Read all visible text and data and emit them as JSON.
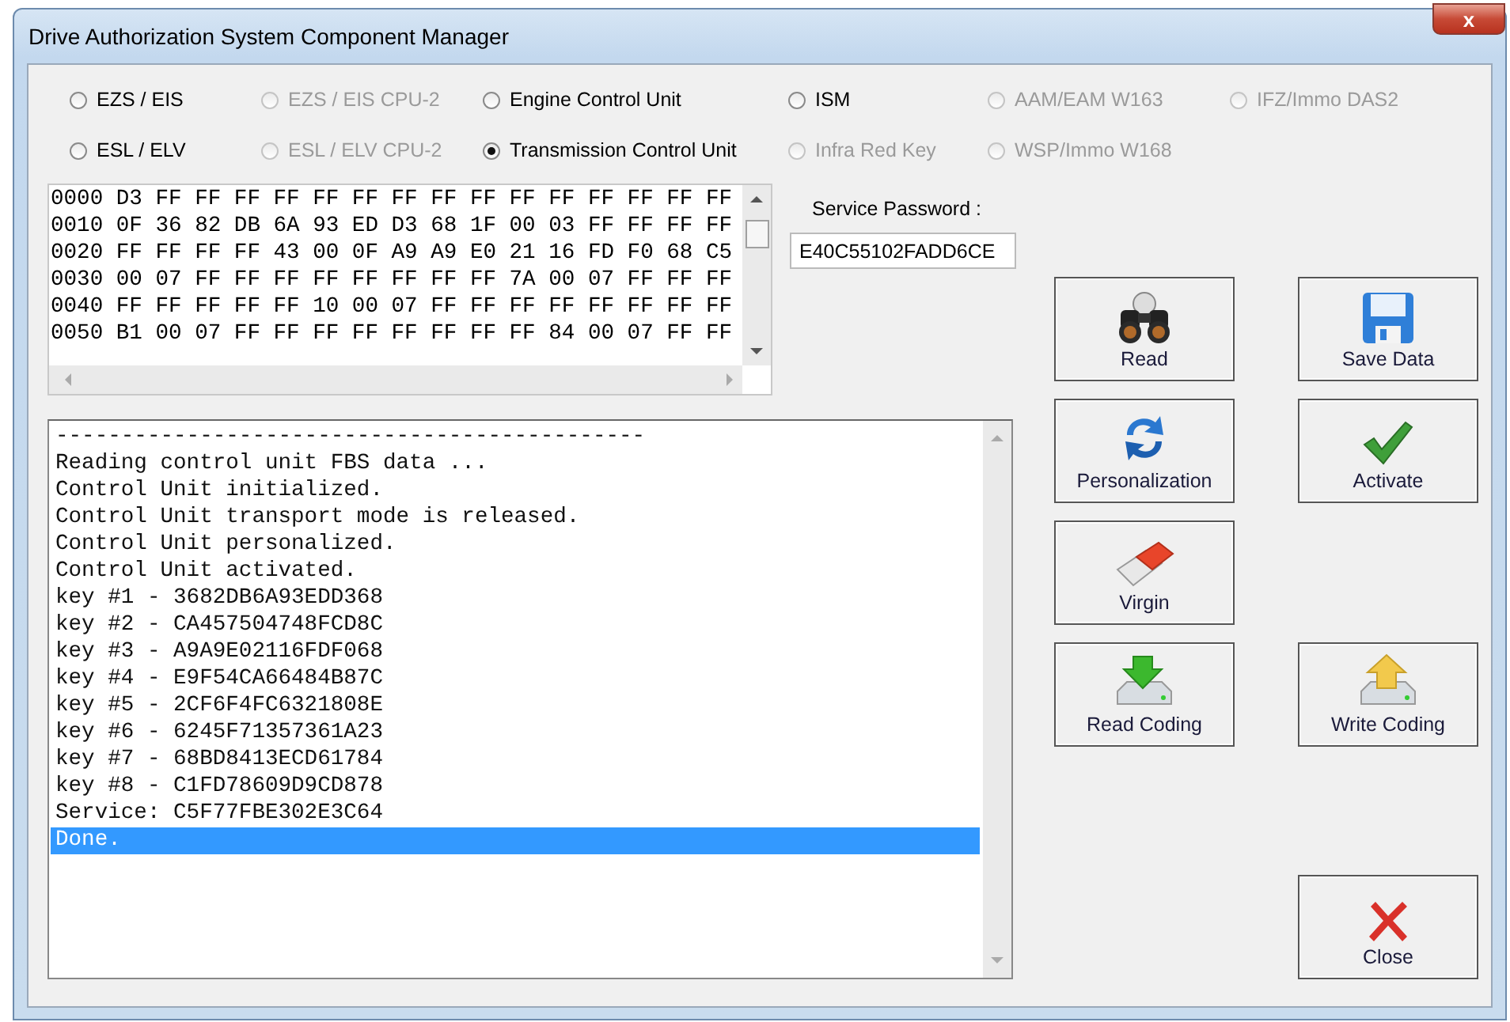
{
  "window": {
    "title": "Drive Authorization System Component Manager",
    "close": "x"
  },
  "radios": [
    {
      "label": "EZS / EIS",
      "selected": false,
      "disabled": false
    },
    {
      "label": "EZS / EIS CPU-2",
      "selected": false,
      "disabled": true
    },
    {
      "label": "Engine Control Unit",
      "selected": false,
      "disabled": false
    },
    {
      "label": "ISM",
      "selected": false,
      "disabled": false
    },
    {
      "label": "AAM/EAM W163",
      "selected": false,
      "disabled": true
    },
    {
      "label": "IFZ/Immo DAS2",
      "selected": false,
      "disabled": true
    },
    {
      "label": "ESL / ELV",
      "selected": false,
      "disabled": false
    },
    {
      "label": "ESL / ELV CPU-2",
      "selected": false,
      "disabled": true
    },
    {
      "label": "Transmission Control Unit",
      "selected": true,
      "disabled": false
    },
    {
      "label": "Infra Red Key",
      "selected": false,
      "disabled": true
    },
    {
      "label": "WSP/Immo W168",
      "selected": false,
      "disabled": true
    }
  ],
  "hex_dump": [
    "0000 D3 FF FF FF FF FF FF FF FF FF FF FF FF FF FF FF",
    "0010 0F 36 82 DB 6A 93 ED D3 68 1F 00 03 FF FF FF FF",
    "0020 FF FF FF FF 43 00 0F A9 A9 E0 21 16 FD F0 68 C5",
    "0030 00 07 FF FF FF FF FF FF FF FF 7A 00 07 FF FF FF",
    "0040 FF FF FF FF FF 10 00 07 FF FF FF FF FF FF FF FF",
    "0050 B1 00 07 FF FF FF FF FF FF FF FF 84 00 07 FF FF"
  ],
  "service_password": {
    "label": "Service Password :",
    "value": "E40C55102FADD6CE"
  },
  "log": [
    {
      "text": "---------------------------------------------",
      "selected": false
    },
    {
      "text": "Reading control unit FBS data ...",
      "selected": false
    },
    {
      "text": "Control Unit initialized.",
      "selected": false
    },
    {
      "text": "Control Unit transport mode is released.",
      "selected": false
    },
    {
      "text": "Control Unit personalized.",
      "selected": false
    },
    {
      "text": "Control Unit activated.",
      "selected": false
    },
    {
      "text": "key #1 - 3682DB6A93EDD368",
      "selected": false
    },
    {
      "text": "key #2 - CA457504748FCD8C",
      "selected": false
    },
    {
      "text": "key #3 - A9A9E02116FDF068",
      "selected": false
    },
    {
      "text": "key #4 - E9F54CA66484B87C",
      "selected": false
    },
    {
      "text": "key #5 - 2CF6F4FC6321808E",
      "selected": false
    },
    {
      "text": "key #6 - 6245F71357361A23",
      "selected": false
    },
    {
      "text": "key #7 - 68BD8413ECD61784",
      "selected": false
    },
    {
      "text": "key #8 - C1FD78609D9CD878",
      "selected": false
    },
    {
      "text": "Service: C5F77FBE302E3C64",
      "selected": false
    },
    {
      "text": "Done.",
      "selected": true
    }
  ],
  "buttons": [
    {
      "label": "Read",
      "kind": "binoculars"
    },
    {
      "label": "Save Data",
      "kind": "floppy"
    },
    {
      "label": "Personalization",
      "kind": "arrows"
    },
    {
      "label": "Activate",
      "kind": "check"
    },
    {
      "label": "Virgin",
      "kind": "eraser"
    },
    {
      "label": "Read Coding",
      "kind": "download"
    },
    {
      "label": "Write Coding",
      "kind": "upload"
    }
  ],
  "close_button": {
    "label": "Close",
    "kind": "cross"
  }
}
